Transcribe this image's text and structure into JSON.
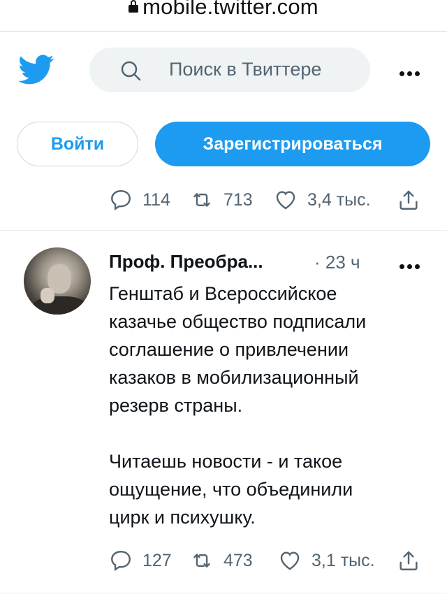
{
  "browser": {
    "url": "mobile.twitter.com"
  },
  "header": {
    "search_placeholder": "Поиск в Твиттере",
    "login_label": "Войти",
    "signup_label": "Зарегистрироваться"
  },
  "colors": {
    "accent": "#1d9bf0",
    "secondary_text": "#536471",
    "search_bg": "#eff3f4"
  },
  "prev_tweet": {
    "replies": "114",
    "retweets": "713",
    "likes": "3,4 тыс."
  },
  "tweet": {
    "author": "Проф. Преобра...",
    "time": "· 23 ч",
    "text_p1": [
      "Генштаб и Всероссийское",
      "казачье общество подписали",
      "соглашение о привлечении",
      "казаков в мобилизационный",
      "резерв страны."
    ],
    "text_p2": [
      "Читаешь новости - и такое",
      "ощущение, что объединили",
      "цирк и психушку."
    ],
    "replies": "127",
    "retweets": "473",
    "likes": "3,1 тыс."
  },
  "icons": [
    "lock-icon",
    "twitter-logo-icon",
    "search-icon",
    "more-icon",
    "reply-icon",
    "retweet-icon",
    "like-icon",
    "share-icon"
  ]
}
